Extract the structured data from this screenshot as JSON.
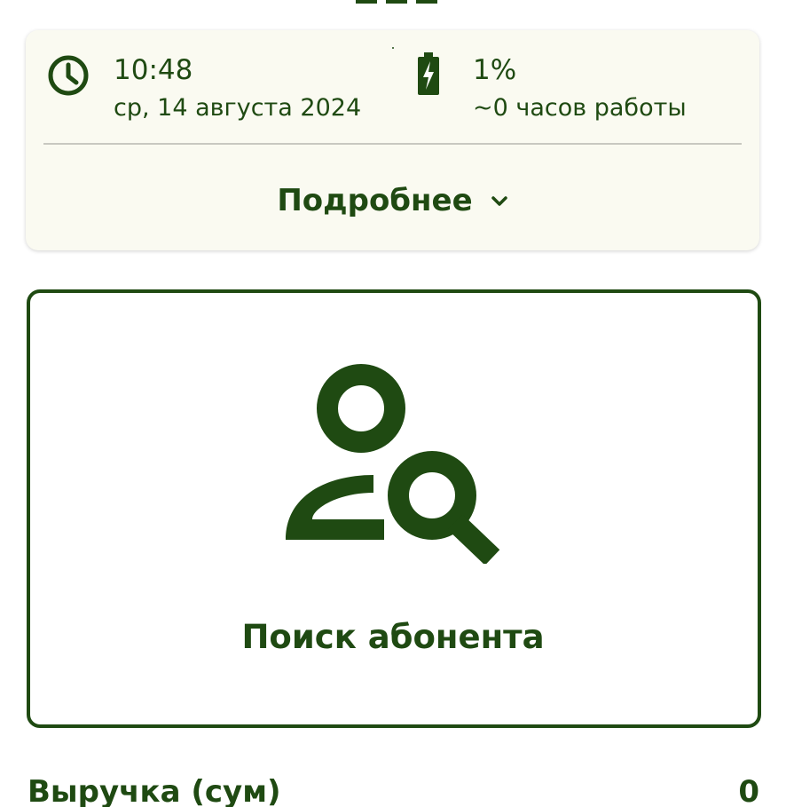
{
  "colors": {
    "primary": "#1f4a12",
    "card_background": "#fafaf1",
    "divider": "#c8c8c1",
    "background": "#ffffff"
  },
  "status": {
    "time": "10:48",
    "date": "ср, 14 августа 2024",
    "battery_percent": "1%",
    "battery_hours": "~0 часов работы",
    "battery_level": 0.01
  },
  "details": {
    "label": "Подробнее",
    "icon": "chevron-down-icon"
  },
  "search": {
    "label": "Поиск абонента",
    "icon": "user-search-icon"
  },
  "revenue": {
    "label": "Выручка (сум)",
    "value": "0"
  }
}
